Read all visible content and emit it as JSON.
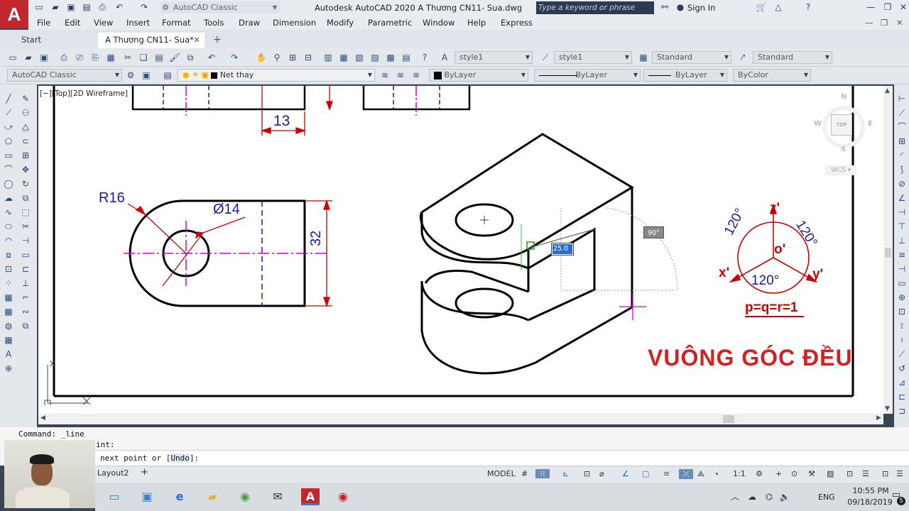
{
  "title_bar": {
    "workspace": "AutoCAD Classic",
    "app_title": "Autodesk AutoCAD 2020   A Thương CN11- Sua.dwg",
    "search_placeholder": "Type a keyword or phrase",
    "sign_in": "Sign In"
  },
  "menu": [
    "File",
    "Edit",
    "View",
    "Insert",
    "Format",
    "Tools",
    "Draw",
    "Dimension",
    "Modify",
    "Parametric",
    "Window",
    "Help",
    "Express"
  ],
  "tabs": {
    "start": "Start",
    "doc": "A Thương CN11- Sua*"
  },
  "toolbar": {
    "text_style": "style1",
    "dim_style": "style1",
    "table_style": "Standard",
    "mleader_style": "Standard",
    "workspace2": "AutoCAD Classic",
    "layer": "Net thay",
    "color": "ByLayer",
    "linetype": "ByLayer",
    "lineweight": "ByLayer",
    "plotstyle": "ByColor"
  },
  "viewport": {
    "label": "[−][Top][2D Wireframe]",
    "compass": {
      "n": "N",
      "s": "S",
      "e": "E",
      "w": "W",
      "top": "TOP",
      "wcs": "WCS"
    }
  },
  "drawing": {
    "dim_13": "13",
    "dim_r16": "R16",
    "dim_d14": "Ø14",
    "dim_32": "32",
    "angle_tip": "90°",
    "input_value": "25.0",
    "axis_z": "z'",
    "axis_x": "x'",
    "axis_y": "y'",
    "axis_o": "o'",
    "angle_l": "120°",
    "angle_r": "120°",
    "angle_b": "120°",
    "ratio": "p=q=r=1",
    "heading": "VUÔNG GÓC ĐỀU",
    "colors": {
      "dim": "#cc0000",
      "blue": "#1a1aa8",
      "center": "#d600d6",
      "hidden": "#1a1aa8",
      "line": "#000000"
    }
  },
  "command": {
    "line1": "Command:  _line",
    "line2": "int:",
    "line3_pre": "next point or [",
    "line3_opt": "Undo",
    "line3_post": "]:"
  },
  "layout_tab": "Layout2",
  "status": {
    "model": "MODEL",
    "scale": "1:1"
  },
  "tray": {
    "lang": "ENG",
    "time": "10:55 PM",
    "date": "09/18/2019",
    "notif": "5"
  }
}
